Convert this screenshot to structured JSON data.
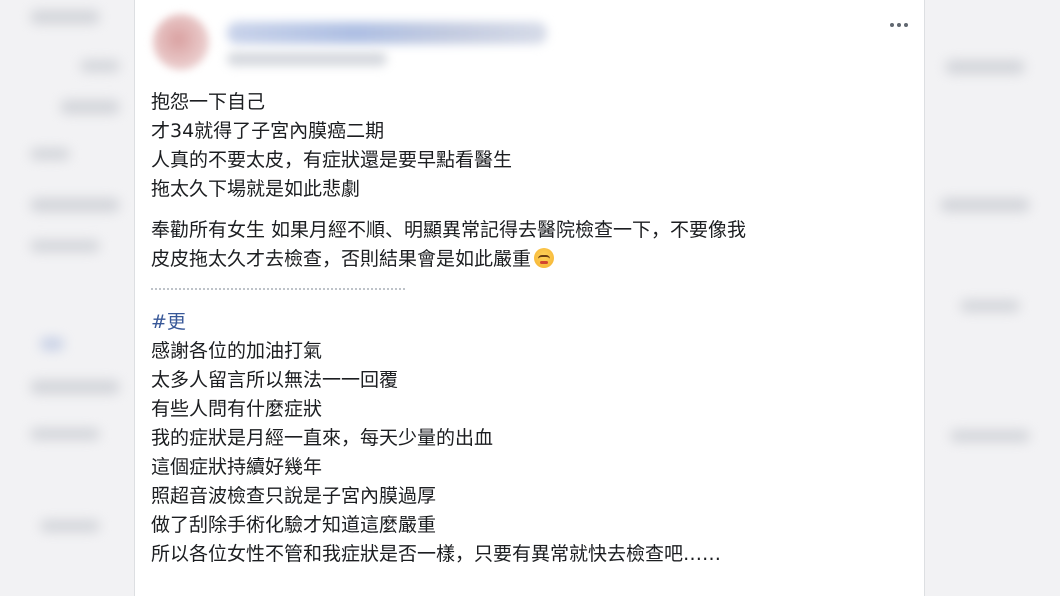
{
  "post": {
    "author_name": "",
    "body_lines_1": [
      "抱怨一下自己",
      "才34就得了子宮內膜癌二期",
      "人真的不要太皮，有症狀還是要早點看醫生",
      "拖太久下場就是如此悲劇"
    ],
    "body_lines_2": [
      "奉勸所有女生 如果月經不順、明顯異常記得去醫院檢查一下，不要像我",
      "皮皮拖太久才去檢查，否則結果會是如此嚴重"
    ],
    "divider": "..........................................",
    "hashtag": "#更",
    "body_lines_3": [
      "感謝各位的加油打氣",
      "太多人留言所以無法一一回覆",
      "有些人問有什麼症狀",
      "我的症狀是月經一直來，每天少量的出血",
      "這個症狀持續好幾年",
      "照超音波檢查只說是子宮內膜過厚",
      "做了刮除手術化驗才知道這麼嚴重",
      "所以各位女性不管和我症狀是否一樣，只要有異常就快去檢查吧……"
    ],
    "emoji_icon": "tired-face-emoji-icon",
    "more_icon": "more-horizontal-icon",
    "link_color": "#385898",
    "text_color": "#1c1e21"
  }
}
